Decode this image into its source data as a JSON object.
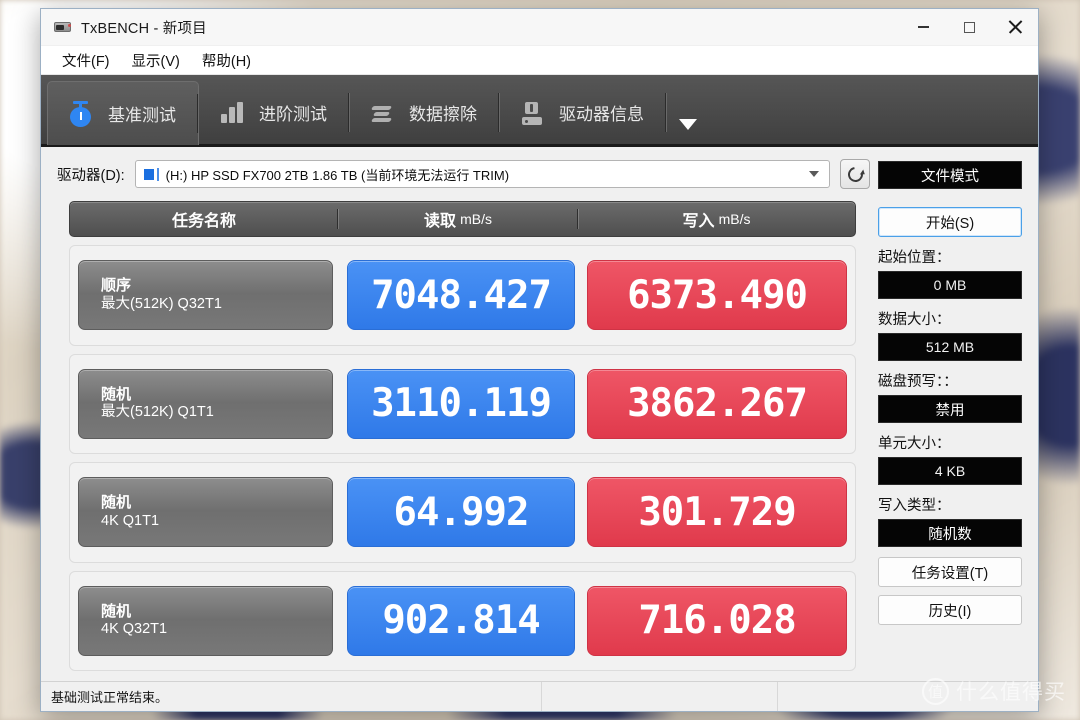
{
  "window": {
    "title": "TxBENCH - 新项目",
    "app_icon": "device-icon",
    "controls": {
      "minimize": "minimize-icon",
      "maximize": "maximize-icon",
      "close": "close-icon"
    }
  },
  "menubar": {
    "items": [
      "文件(F)",
      "显示(V)",
      "帮助(H)"
    ]
  },
  "tabs": [
    {
      "label": "基准测试",
      "icon": "stopwatch-icon",
      "active": true
    },
    {
      "label": "进阶测试",
      "icon": "bar-chart-icon",
      "active": false
    },
    {
      "label": "数据擦除",
      "icon": "erase-icon",
      "active": false
    },
    {
      "label": "驱动器信息",
      "icon": "drive-info-icon",
      "active": false
    }
  ],
  "tab_overflow_icon": "chevron-down-icon",
  "drive": {
    "label": "驱动器(D):",
    "value": "(H:) HP SSD FX700 2TB  1.86 TB (当前环境无法运行 TRIM)",
    "icon": "drive-icon",
    "dropdown_icon": "chevron-down-icon",
    "refresh_icon": "refresh-icon"
  },
  "table": {
    "headers": {
      "task": "任务名称",
      "read": "读取",
      "read_unit": "mB/s",
      "write": "写入",
      "write_unit": "mB/s"
    },
    "rows": [
      {
        "task_main": "顺序",
        "task_sub": "最大(512K) Q32T1",
        "read": "7048.427",
        "write": "6373.490"
      },
      {
        "task_main": "随机",
        "task_sub": "最大(512K) Q1T1",
        "read": "3110.119",
        "write": "3862.267"
      },
      {
        "task_main": "随机",
        "task_sub": "4K Q1T1",
        "read": "64.992",
        "write": "301.729"
      },
      {
        "task_main": "随机",
        "task_sub": "4K Q32T1",
        "read": "902.814",
        "write": "716.028"
      }
    ]
  },
  "sidebar": {
    "mode_button": "文件模式",
    "start_button": "开始(S)",
    "start_pos_label": "起始位置：",
    "start_pos_value": "0 MB",
    "data_size_label": "数据大小：",
    "data_size_value": "512 MB",
    "prewrite_label": "磁盘预写：：",
    "prewrite_value": "禁用",
    "unit_size_label": "单元大小：",
    "unit_size_value": "4 KB",
    "write_type_label": "写入类型：",
    "write_type_value": "随机数",
    "task_settings_button": "任务设置(T)",
    "history_button": "历史(I)"
  },
  "status": {
    "text": "基础测试正常结束。"
  },
  "watermark": {
    "badge": "值",
    "text": "什么值得买"
  },
  "colors": {
    "read_chip": "#3b82f0",
    "write_chip": "#e8404f",
    "accent": "#2f86f2"
  }
}
